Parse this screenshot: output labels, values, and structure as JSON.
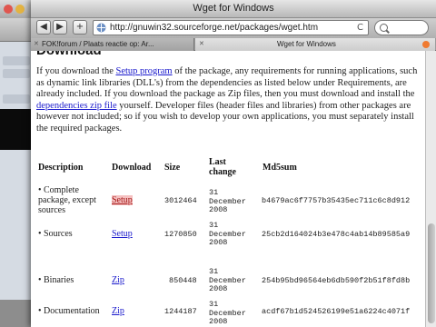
{
  "window": {
    "title": "Wget for Windows"
  },
  "toolbar": {
    "back_label": "◀",
    "forward_label": "▶",
    "add_label": "+",
    "url": "http://gnuwin32.sourceforge.net/packages/wget.htm",
    "reload_label": "C"
  },
  "tabs": [
    {
      "label": "FOK!forum / Plaats reactie op: Ar...",
      "active": false
    },
    {
      "label": "Wget for Windows",
      "active": true
    }
  ],
  "content": {
    "heading": "Download",
    "para_1": "If you download the ",
    "link_setup_program": "Setup program",
    "para_2": " of the package, any requirements for running applications, such as dynamic link libraries (DLL's) from the dependencies as listed below under Requirements, are already included. If you download the package as Zip files, then you must download and install the ",
    "link_dependencies_zip": "dependencies zip file",
    "para_3": " yourself. Developer files (header files and libraries) from other packages are however not included; so if you wish to develop your own applications, you must separately install the required packages."
  },
  "table": {
    "headers": {
      "description": "Description",
      "download": "Download",
      "size": "Size",
      "last_change": "Last change",
      "md5sum": "Md5sum"
    },
    "rows": [
      {
        "description": "• Complete package, except sources",
        "download": "Setup",
        "size": "3012464",
        "date": "31 December 2008",
        "md5": "b4679ac6f7757b35435ec711c6c8d912"
      },
      {
        "description": "• Sources",
        "download": "Setup",
        "size": "1270850",
        "date": "31 December 2008",
        "md5": "25cb2d164024b3e478c4ab14b89585a9"
      },
      {
        "description": "• Binaries",
        "download": "Zip",
        "size": "850448",
        "date": "31 December 2008",
        "md5": "254b95bd96564eb6db590f2b51f8fd8b"
      },
      {
        "description": "• Documentation",
        "download": "Zip",
        "size": "1244187",
        "date": "31 December 2008",
        "md5": "acdf67b1d524526199e51a6224c4071f"
      }
    ]
  },
  "colors": {
    "link": "#1a1acc",
    "hovered_link_bg": "#f5c0c0",
    "tab_favicon": "#f07a30"
  },
  "icons": [
    "back-arrow-icon",
    "forward-arrow-icon",
    "add-bookmark-icon",
    "site-favicon-icon",
    "reload-icon",
    "search-icon",
    "tab-close-icon",
    "mouse-cursor-icon"
  ]
}
